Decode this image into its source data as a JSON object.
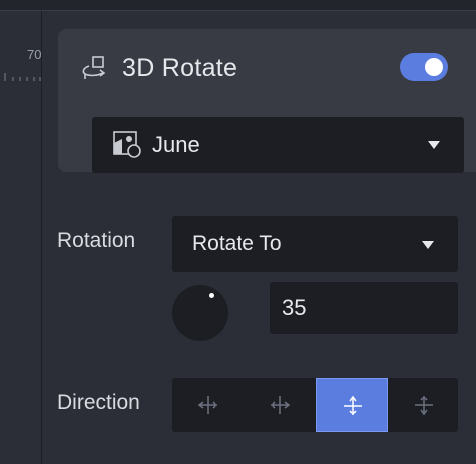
{
  "ruler": {
    "label": "70"
  },
  "card": {
    "title": "3D Rotate",
    "title_icon": "rotate-3d-icon",
    "enabled": true,
    "target": {
      "value": "June",
      "icon": "image-shapes-icon"
    }
  },
  "rotation": {
    "label": "Rotation",
    "mode": "Rotate To",
    "value": "35"
  },
  "direction": {
    "label": "Direction",
    "options": [
      {
        "name": "flip-horizontal-left",
        "icon": "flip-horizontal-left-icon",
        "active": false
      },
      {
        "name": "flip-horizontal-right",
        "icon": "flip-horizontal-right-icon",
        "active": false
      },
      {
        "name": "flip-vertical-up",
        "icon": "flip-vertical-up-icon",
        "active": true
      },
      {
        "name": "flip-vertical-down",
        "icon": "flip-vertical-down-icon",
        "active": false
      }
    ]
  },
  "colors": {
    "accent": "#5b7de0",
    "panel_bg": "#2b2e36",
    "card_bg": "#383b44",
    "field_bg": "#1c1e23",
    "text": "#e6e8ec"
  }
}
